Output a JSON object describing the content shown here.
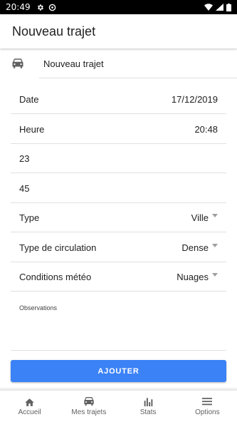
{
  "status_bar": {
    "time": "20:49",
    "left_icons": [
      "gear-icon",
      "at-icon"
    ],
    "right_icons": [
      "wifi-icon",
      "signal-icon",
      "battery-icon"
    ]
  },
  "app_bar": {
    "title": "Nouveau trajet"
  },
  "trip_name": {
    "icon": "car-icon",
    "value": "Nouveau trajet"
  },
  "form": {
    "date": {
      "label": "Date",
      "value": "17/12/2019"
    },
    "time": {
      "label": "Heure",
      "value": "20:48"
    },
    "field_1": {
      "value": "23"
    },
    "field_2": {
      "value": "45"
    },
    "type": {
      "label": "Type",
      "value": "Ville"
    },
    "traffic": {
      "label": "Type de circulation",
      "value": "Dense"
    },
    "weather": {
      "label": "Conditions météo",
      "value": "Nuages"
    },
    "observations": {
      "label": "Observations"
    }
  },
  "add_button": {
    "label": "AJOUTER"
  },
  "accent_color": "#3b82f6",
  "bottom_nav": {
    "items": [
      {
        "label": "Accueil",
        "icon": "home-icon"
      },
      {
        "label": "Mes trajets",
        "icon": "car-icon"
      },
      {
        "label": "Stats",
        "icon": "bar-chart-icon"
      },
      {
        "label": "Options",
        "icon": "menu-icon"
      }
    ]
  }
}
